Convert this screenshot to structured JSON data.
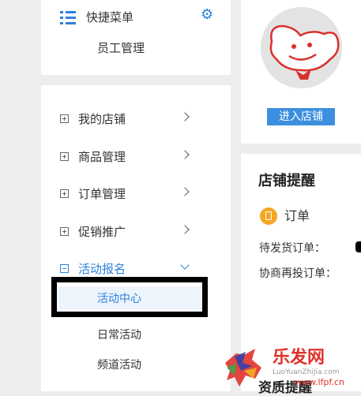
{
  "quick_menu": {
    "title": "快捷菜单",
    "items": [
      "员工管理"
    ]
  },
  "menu": {
    "items": [
      {
        "label": "我的店铺"
      },
      {
        "label": "商品管理"
      },
      {
        "label": "订单管理"
      },
      {
        "label": "促销推广"
      },
      {
        "label": "活动报名"
      }
    ],
    "sub_items": [
      {
        "label": "活动中心"
      },
      {
        "label": "日常活动"
      },
      {
        "label": "频道活动"
      }
    ]
  },
  "shop": {
    "enter_label": "进入店铺"
  },
  "notice": {
    "title": "店铺提醒",
    "order_heading": "订单",
    "pending_ship": "待发货订单：",
    "negotiate": "协商再投订单：",
    "qualification_title": "资质提醒"
  },
  "watermark": {
    "cn": "乐发网",
    "pinyin": "LuoYuanZhiJia.com",
    "url": "www.lfpf.cn"
  },
  "colors": {
    "accent": "#2b82dc",
    "button": "#3c8fde",
    "order_icon": "#f5a623",
    "watermark_red": "#e0312b"
  }
}
